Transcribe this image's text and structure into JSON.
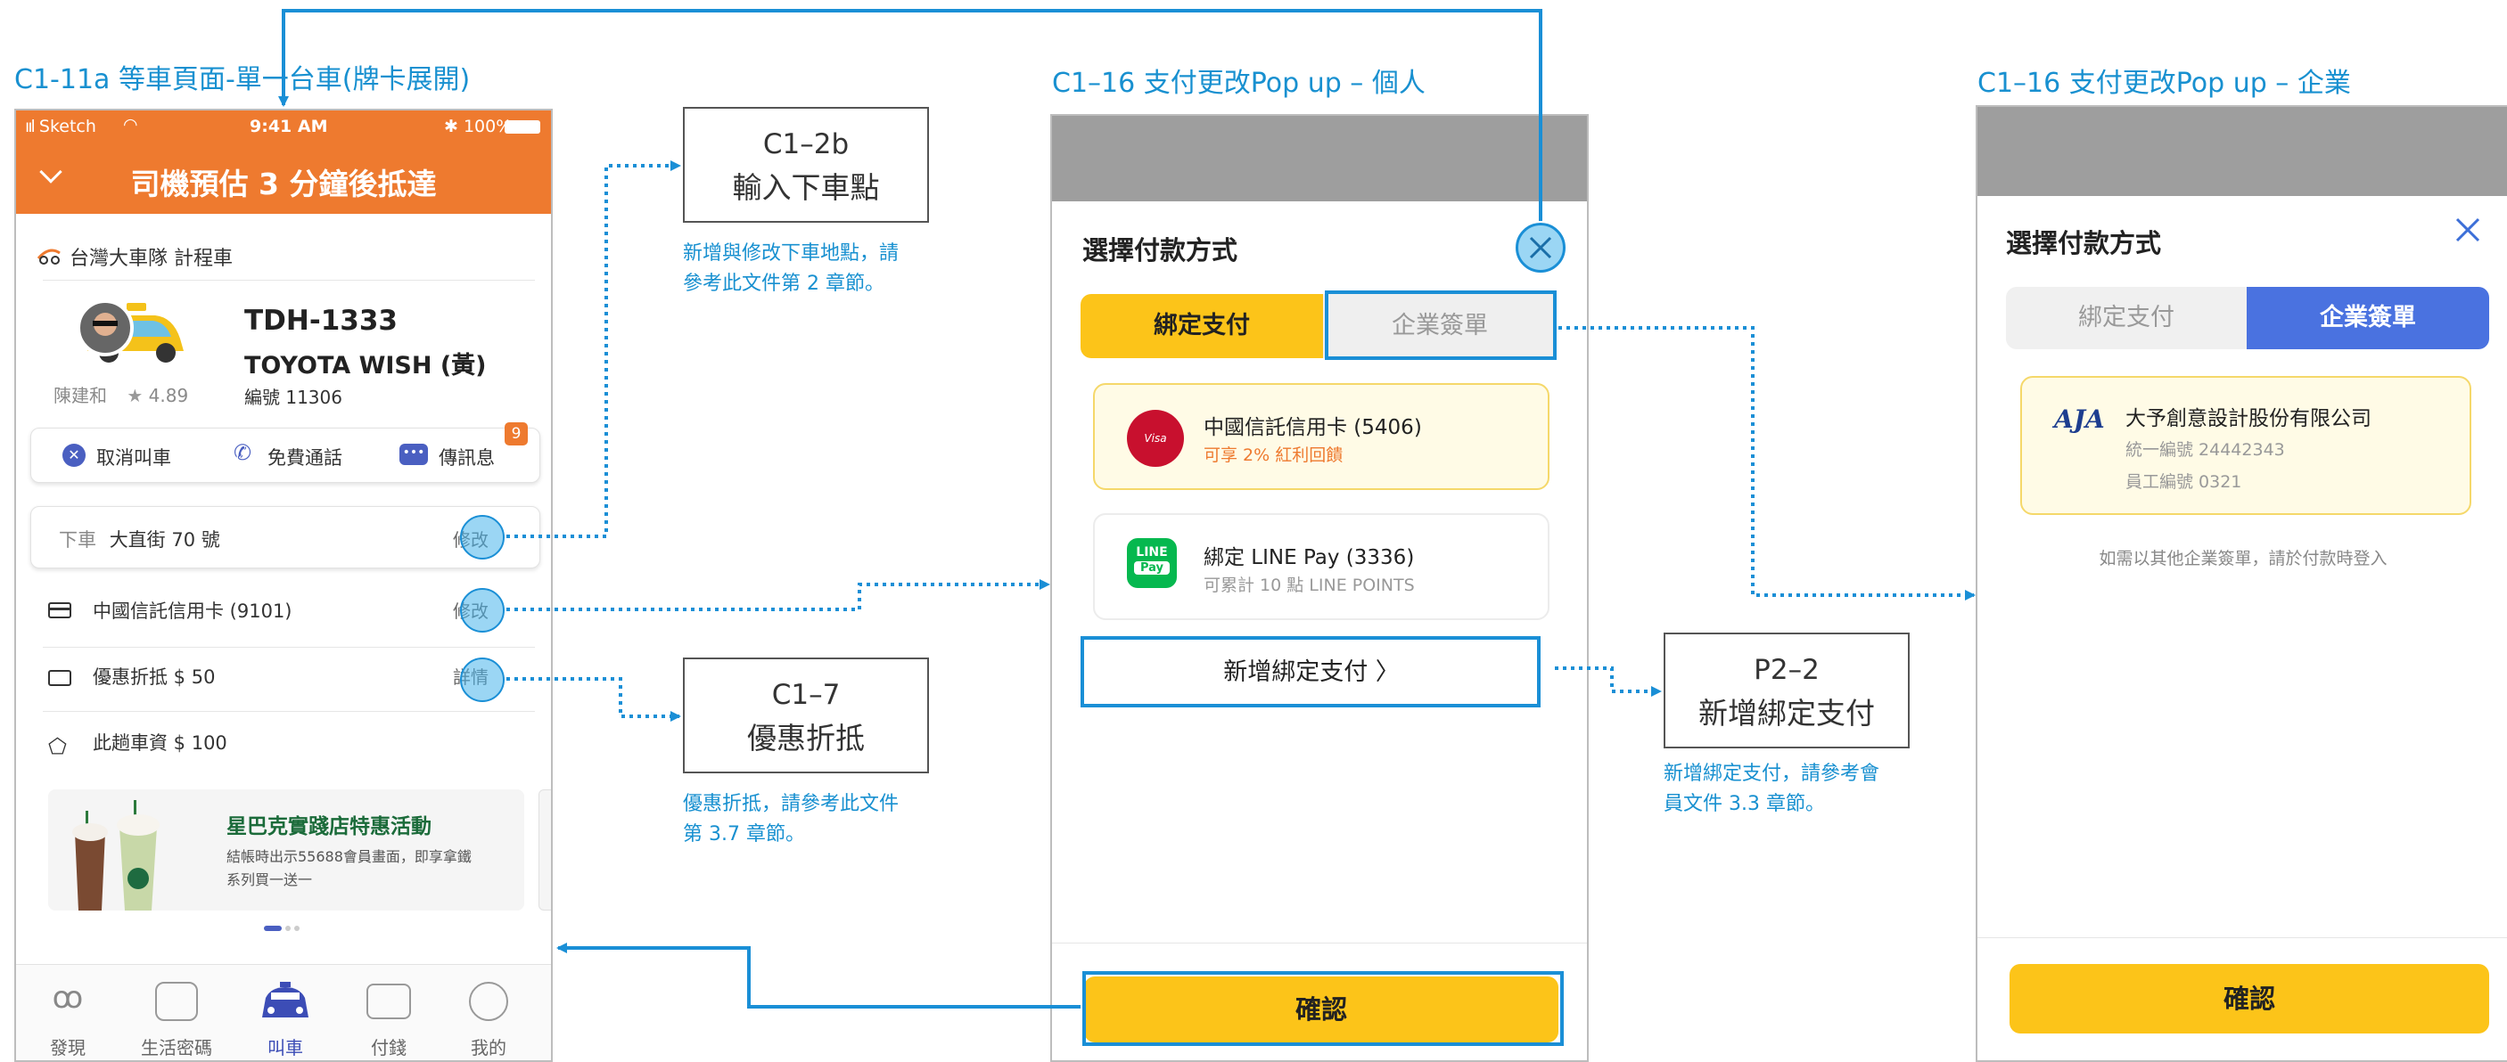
{
  "frames": {
    "left_title": "C1-11a 等車頁面-單一台車(牌卡展開)",
    "mid_title": "C1–16 支付更改Pop up – 個人",
    "right_title": "C1–16 支付更改Pop up – 企業"
  },
  "phone": {
    "status": {
      "carrier": "Sketch",
      "time": "9:41 AM",
      "battery": "100%"
    },
    "header_title": "司機預估 3 分鐘後抵達",
    "fleet": "台灣大車隊 計程車",
    "plate": "TDH-1333",
    "car_model": "TOYOTA WISH (黃)",
    "driver_name": "陳建和",
    "rating": "4.89",
    "vehicle_no": "編號 11306",
    "actions": {
      "cancel": "取消叫車",
      "call": "免費通話",
      "message": "傳訊息",
      "message_badge": "9"
    },
    "dropoff_label": "下車",
    "dropoff_value": "大直街 70 號",
    "dropoff_action": "修改",
    "payment_value": "中國信託信用卡 (9101)",
    "payment_action": "修改",
    "discount_value": "優惠折抵 $ 50",
    "discount_action": "詳情",
    "fare_value": "此趟車資 $ 100",
    "promo": {
      "title": "星巴克實踐店特惠活動",
      "desc_line1": "結帳時出示55688會員畫面，即享拿鐵",
      "desc_line2": "系列買一送一"
    },
    "nav": [
      "發現",
      "生活密碼",
      "叫車",
      "付錢",
      "我的"
    ]
  },
  "boxes": {
    "c1_2b": {
      "code": "C1–2b",
      "label": "輸入下車點",
      "note_line1": "新增與修改下車地點，請",
      "note_line2": "參考此文件第 2 章節。"
    },
    "c1_7": {
      "code": "C1–7",
      "label": "優惠折抵",
      "note_line1": "優惠折抵，請參考此文件",
      "note_line2": "第 3.7 章節。"
    },
    "p2_2": {
      "code": "P2–2",
      "label": "新增綁定支付",
      "note_line1": "新增綁定支付，請參考會",
      "note_line2": "員文件 3.3 章節。"
    }
  },
  "modal_personal": {
    "title": "選擇付款方式",
    "tab_bound": "綁定支付",
    "tab_corporate": "企業簽單",
    "card1_name": "中國信託信用卡 (5406)",
    "card1_note": "可享 2% 紅利回饋",
    "card2_name": "綁定 LINE Pay (3336)",
    "card2_note": "可累計 10 點 LINE POINTS",
    "line_icon_top": "LINE",
    "line_icon_bottom": "Pay",
    "add_payment": "新增綁定支付 〉",
    "confirm": "確認"
  },
  "modal_corporate": {
    "title": "選擇付款方式",
    "tab_bound": "綁定支付",
    "tab_corporate": "企業簽單",
    "logo": "AJA",
    "company": "大予創意設計股份有限公司",
    "tax_id": "統一編號 24442343",
    "employee_id": "員工編號 0321",
    "hint": "如需以其他企業簽單，請於付款時登入",
    "confirm": "確認"
  },
  "colors": {
    "accent_blue": "#1a8fd6",
    "orange": "#ee7a2f",
    "yellow": "#fcc419",
    "corporate_blue": "#4a72e0"
  },
  "icons": [
    "wifi-icon",
    "chevron-down-icon",
    "taxi-logo-icon",
    "car-icon",
    "star-icon",
    "cancel-icon",
    "phone-icon",
    "chat-icon",
    "card-icon",
    "coupon-icon",
    "tag-icon",
    "close-icon",
    "discover-icon",
    "coupon-nav-icon",
    "taxi-nav-icon",
    "wallet-icon",
    "profile-icon"
  ]
}
